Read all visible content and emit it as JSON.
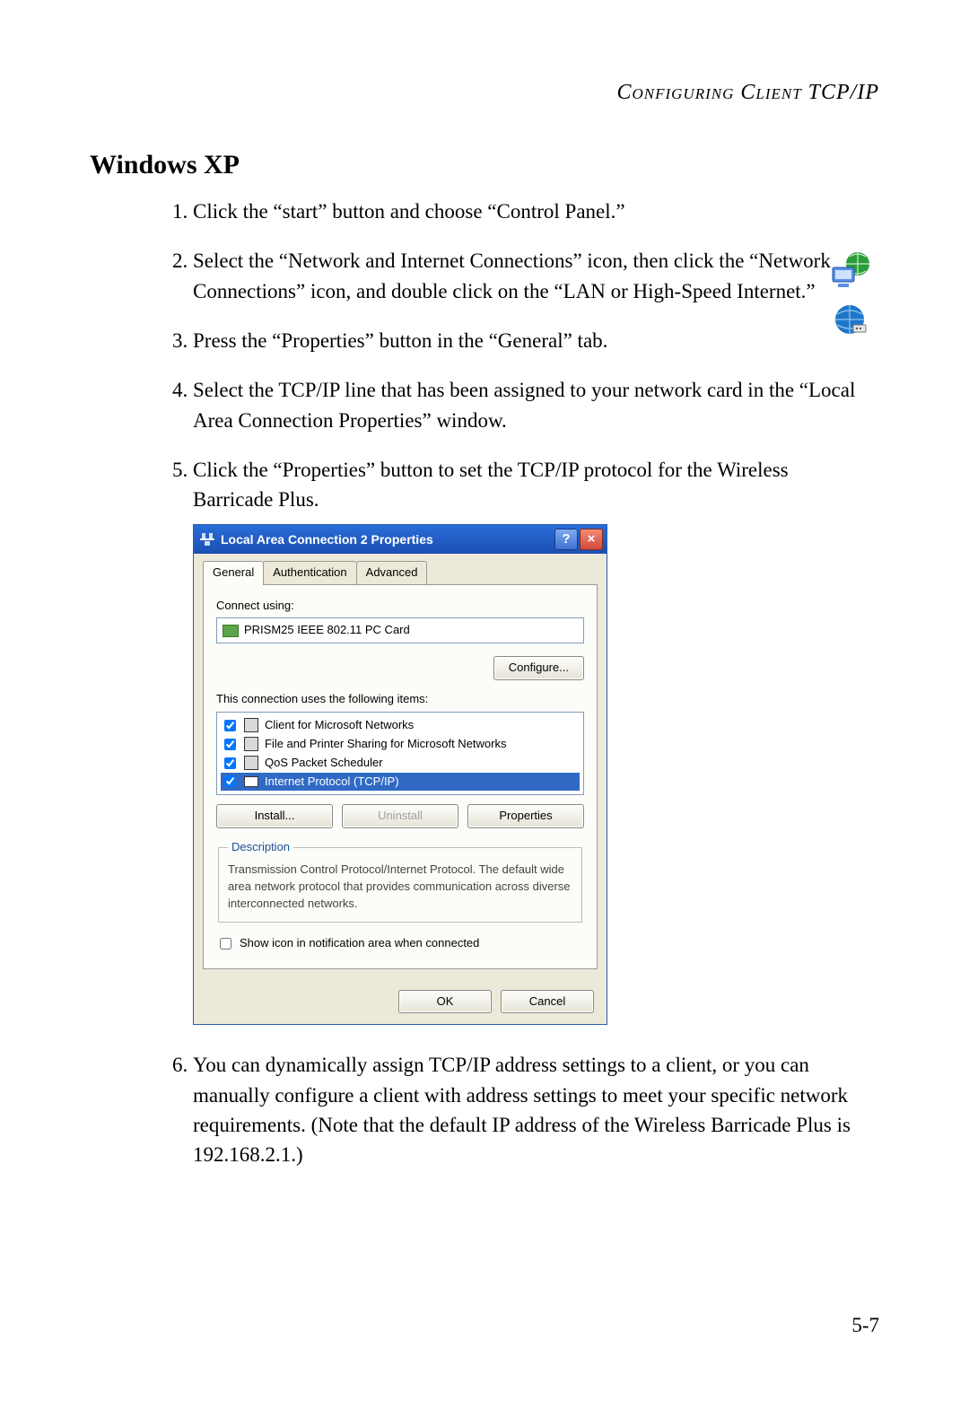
{
  "header": "Configuring Client TCP/IP",
  "section_title": "Windows XP",
  "steps": {
    "s1": "Click the “start” button and choose “Control Panel.”",
    "s2": "Select the “Network and Internet Connections” icon, then click the “Network Connections” icon, and double click on the “LAN or High-Speed Internet.”",
    "s3": "Press the “Properties” button in the “General” tab.",
    "s4": "Select the TCP/IP line that has been assigned to your network card in the “Local Area Connection Properties” window.",
    "s5": "Click the “Properties” button to set the TCP/IP protocol for the Wireless Barricade Plus.",
    "s6": "You can dynamically assign TCP/IP address settings to a client, or you can manually configure a client with address settings to meet your specific network requirements. (Note that the default IP address of the Wireless Barricade Plus is 192.168.2.1.)"
  },
  "dialog": {
    "title": "Local Area Connection 2 Properties",
    "tabs": {
      "general": "General",
      "auth": "Authentication",
      "adv": "Advanced"
    },
    "connect_using_label": "Connect using:",
    "adapter": "PRISM25 IEEE 802.11 PC Card",
    "configure": "Configure...",
    "uses_label": "This connection uses the following items:",
    "items": {
      "i0": "Client for Microsoft Networks",
      "i1": "File and Printer Sharing for Microsoft Networks",
      "i2": "QoS Packet Scheduler",
      "i3": "Internet Protocol (TCP/IP)"
    },
    "install": "Install...",
    "uninstall": "Uninstall",
    "properties": "Properties",
    "desc_legend": "Description",
    "desc_text": "Transmission Control Protocol/Internet Protocol. The default wide area network protocol that provides communication across diverse interconnected networks.",
    "show_icon": "Show icon in notification area when connected",
    "ok": "OK",
    "cancel": "Cancel"
  },
  "pagenum": "5-7"
}
